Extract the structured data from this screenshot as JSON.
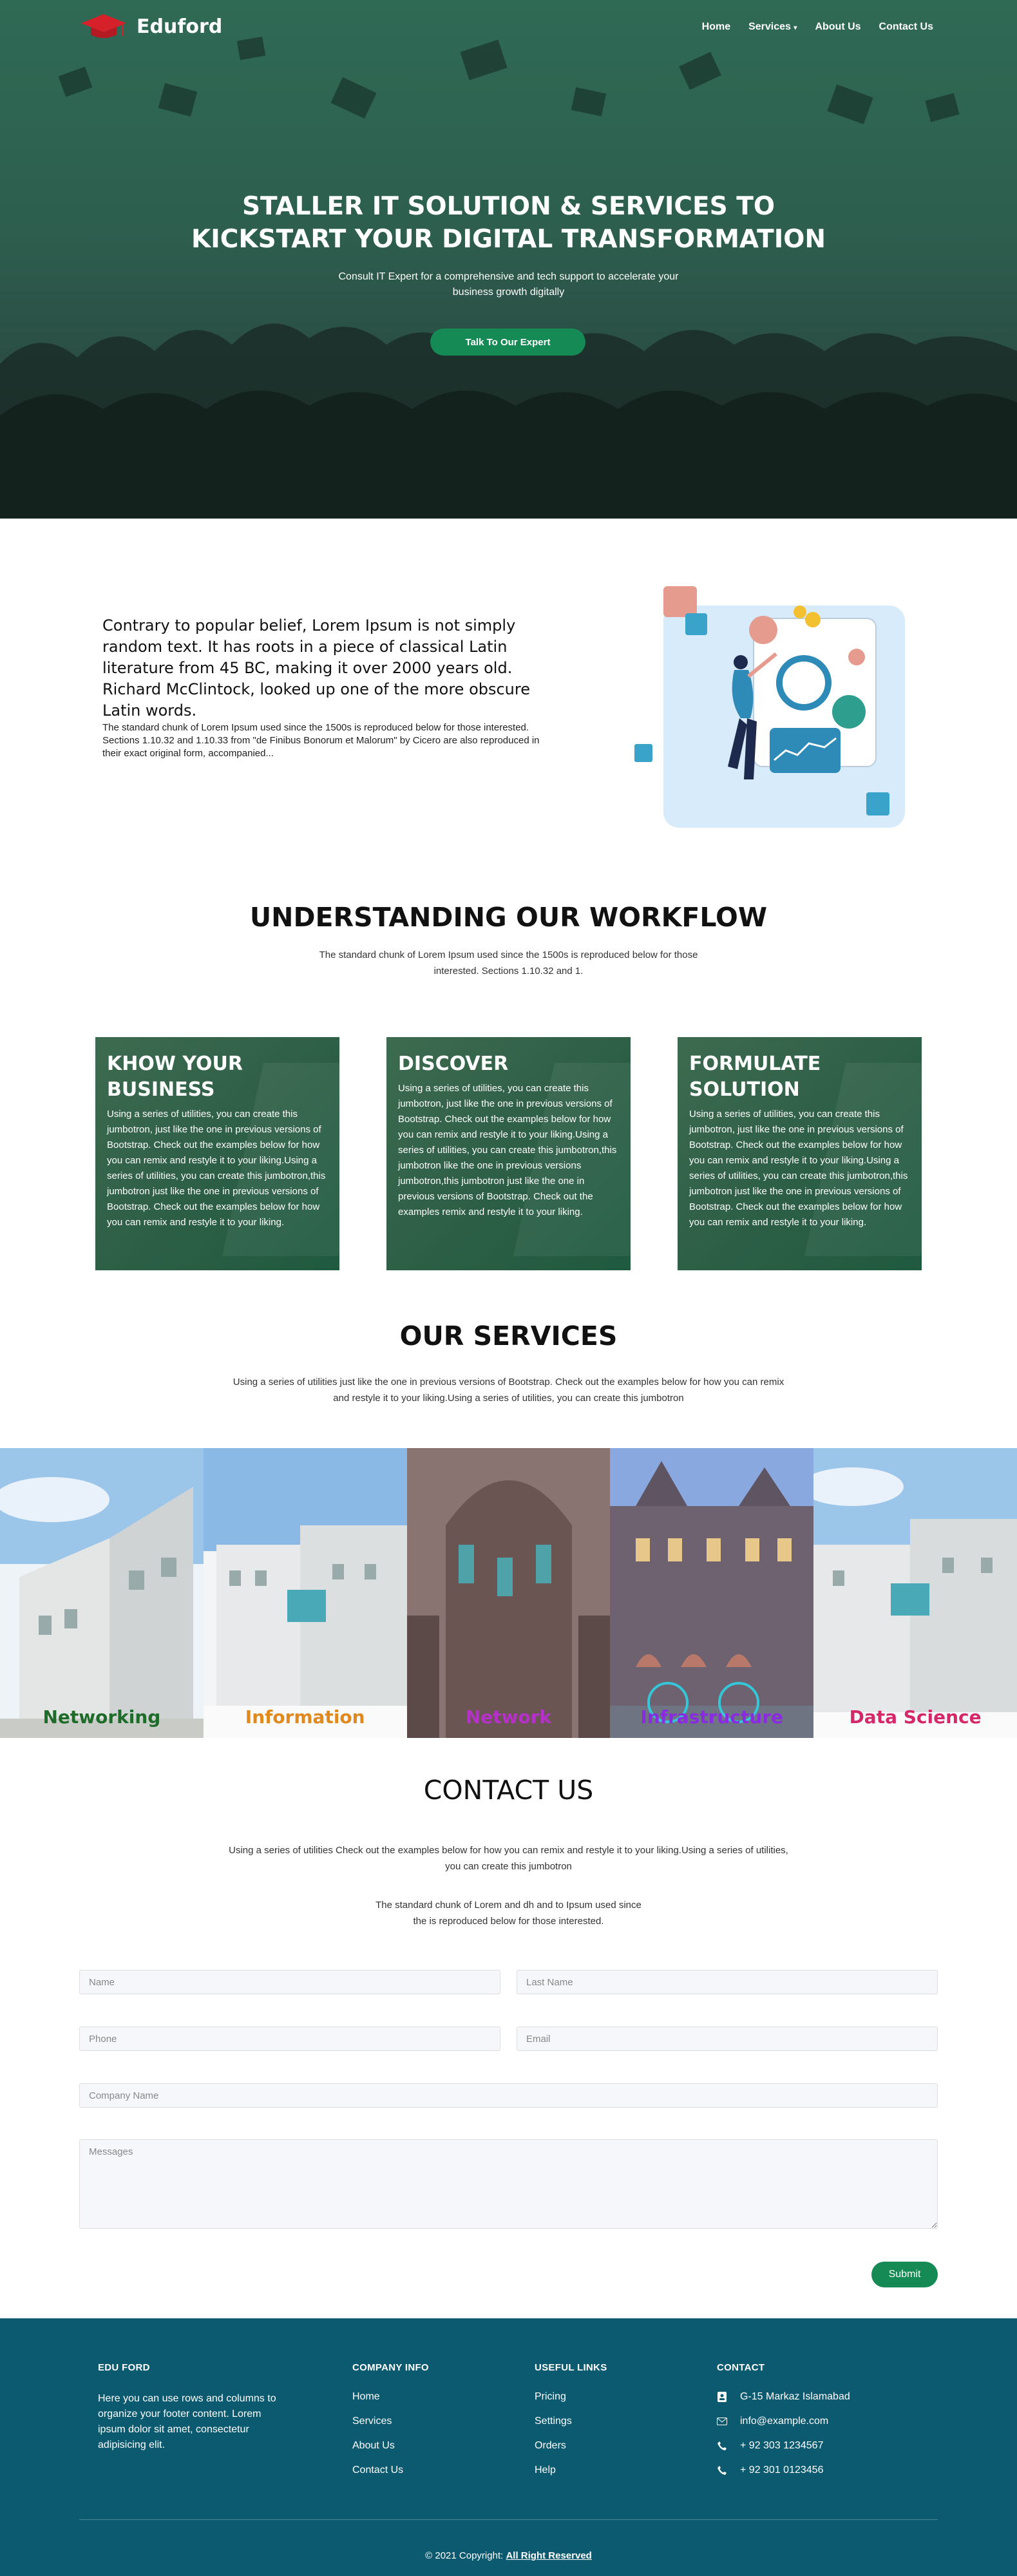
{
  "brand": {
    "name": "Eduford",
    "accent": "#158a54",
    "footer_bg": "#0c5a70"
  },
  "nav": {
    "items": [
      {
        "label": "Home"
      },
      {
        "label": "Services"
      },
      {
        "label": "About Us"
      },
      {
        "label": "Contact Us"
      }
    ]
  },
  "hero": {
    "title_line1": "STALLER IT SOLUTION & SERVICES TO",
    "title_line2": "KICKSTART YOUR DIGITAL TRANSFORMATION",
    "subtitle": "Consult IT Expert for a comprehensive and tech support to accelerate your business growth digitally",
    "cta": "Talk To Our Expert"
  },
  "intro": {
    "heading": "Contrary to popular belief, Lorem Ipsum is not simply random text. It has roots in a piece of classical Latin literature from 45 BC, making it over 2000 years old. Richard McClintock, looked up one of the more obscure Latin words.",
    "text": "The standard chunk of Lorem Ipsum used since the 1500s is reproduced below for those interested. Sections 1.10.32 and 1.10.33 from \"de Finibus Bonorum et Malorum\" by Cicero are also reproduced in their exact original form, accompanied..."
  },
  "workflow": {
    "title": "UNDERSTANDING OUR WORKFLOW",
    "text": "The standard chunk of Lorem Ipsum used since the 1500s is reproduced below for those interested. Sections 1.10.32 and 1.",
    "cards": [
      {
        "title": "KHOW YOUR BUSINESS",
        "text": "Using a series of utilities, you can create this jumbotron, just like the one in previous versions of Bootstrap. Check out the examples below for how you can remix and restyle it to your liking.Using a series of utilities, you can create this jumbotron,this jumbotron just like the one in previous versions of Bootstrap. Check out the examples below for how you can remix and restyle it to your liking."
      },
      {
        "title": "DISCOVER",
        "text": "Using a series of utilities, you can create this jumbotron, just like the one in previous versions of Bootstrap. Check out the examples below for how you can remix and restyle it to your liking.Using a series of utilities, you can create this jumbotron,this jumbotron like the one in previous versions jumbotron,this jumbotron just like the one in previous versions of Bootstrap. Check out the examples remix and restyle it to your liking."
      },
      {
        "title": "FORMULATE SOLUTION",
        "text": "Using a series of utilities, you can create this jumbotron, just like the one in previous versions of Bootstrap. Check out the examples below for how you can remix and restyle it to your liking.Using a series of utilities, you can create this jumbotron,this jumbotron just like the one in previous versions of Bootstrap. Check out the examples below for how you can remix and restyle it to your liking."
      }
    ]
  },
  "services": {
    "title": "OUR SERVICES",
    "text": "Using a series of utilities just like the one in previous versions of Bootstrap. Check out the examples below for how you can remix and restyle it to your liking.Using a series of utilities, you can create this jumbotron",
    "items": [
      {
        "label": "Networking",
        "color": "#1f6b2a"
      },
      {
        "label": "Information",
        "color": "#e08a1e"
      },
      {
        "label": "Network",
        "color": "#b531c9"
      },
      {
        "label": "Infrastructure",
        "color": "#8a2be2"
      },
      {
        "label": "Data Science",
        "color": "#d4286b"
      }
    ]
  },
  "contact": {
    "title": "CONTACT US",
    "text1": "Using a series of utilities Check out the examples below for how you can remix and restyle it to your liking.Using a series of utilities, you can create this jumbotron",
    "text2": "The standard chunk of Lorem and dh and to Ipsum used since the is reproduced below for those interested.",
    "placeholders": {
      "name": "Name",
      "last_name": "Last Name",
      "phone": "Phone",
      "email": "Email",
      "company": "Company Name",
      "messages": "Messages"
    },
    "submit": "Submit"
  },
  "footer": {
    "about_title": "EDU FORD",
    "about_text": "Here you can use rows and columns to organize your footer content. Lorem ipsum dolor sit amet, consectetur adipisicing elit.",
    "company_title": "COMPANY INFO",
    "company_links": [
      "Home",
      "Services",
      "About Us",
      "Contact Us"
    ],
    "useful_title": "USEFUL LINKS",
    "useful_links": [
      "Pricing",
      "Settings",
      "Orders",
      "Help"
    ],
    "contact_title": "CONTACT",
    "address": "G-15 Markaz Islamabad",
    "email": "info@example.com",
    "phone1": "+ 92 303 1234567",
    "phone2": "+ 92 301 0123456",
    "copyright": "© 2021 Copyright:",
    "rights": "All Right Reserved"
  }
}
